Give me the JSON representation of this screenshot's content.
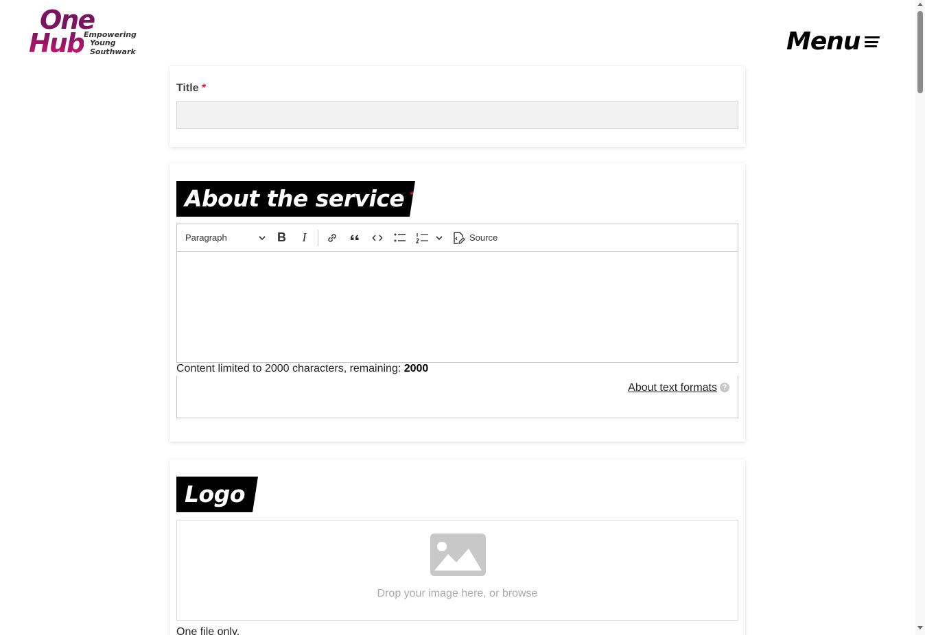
{
  "header": {
    "logo": {
      "line1": "One",
      "line2": "Hub",
      "tagline1": "Empowering",
      "tagline2": "Young Southwark"
    },
    "menu_label": "Menu",
    "menu_icon": "hamburger-icon"
  },
  "title_field": {
    "label": "Title",
    "required_mark": "*",
    "value": ""
  },
  "about": {
    "heading": "About the service",
    "required_mark": "*",
    "toolbar": {
      "paragraph_select": "Paragraph",
      "buttons": [
        "bold-icon",
        "italic-icon",
        "link-icon",
        "blockquote-icon",
        "code-icon",
        "bulleted-list-icon",
        "numbered-list-icon"
      ],
      "source_label": "Source"
    },
    "char_limit_text": "Content limited to 2000 characters, remaining: ",
    "char_remaining": "2000",
    "formats_link": "About text formats",
    "help_glyph": "?"
  },
  "logo_section": {
    "heading": "Logo",
    "drop_text": "Drop your image here, or browse",
    "file_note": "One file only."
  },
  "colors": {
    "brand": "#7a1460",
    "required": "#e32636",
    "heading_bg": "#000000"
  }
}
